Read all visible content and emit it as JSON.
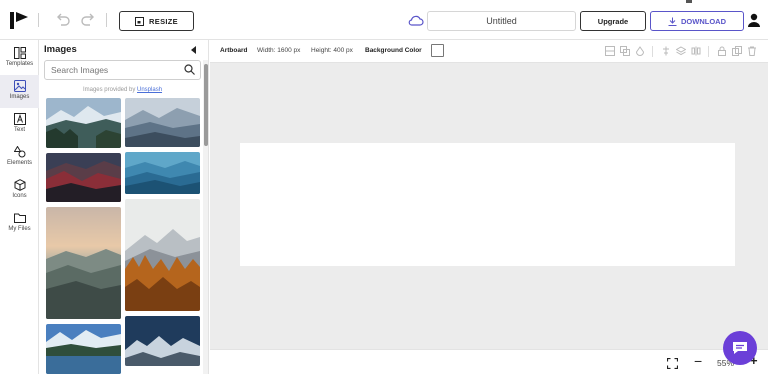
{
  "header": {
    "resize_label": "RESIZE",
    "title_value": "Untitled",
    "upgrade_label": "Upgrade",
    "download_label": "DOWNLOAD"
  },
  "sidebar": {
    "items": [
      {
        "label": "Templates",
        "icon": "templates-icon"
      },
      {
        "label": "Images",
        "icon": "image-icon",
        "active": true
      },
      {
        "label": "Text",
        "icon": "text-icon"
      },
      {
        "label": "Elements",
        "icon": "shapes-icon"
      },
      {
        "label": "Icons",
        "icon": "cube-icon"
      },
      {
        "label": "My Files",
        "icon": "folder-icon"
      }
    ]
  },
  "panel": {
    "title": "Images",
    "search_placeholder": "Search Images",
    "provided_text": "Images provided by",
    "provider_link": "Unsplash"
  },
  "artboard_bar": {
    "artboard_label": "Artboard",
    "width_text": "Width: 1600 px",
    "height_text": "Height: 400 px",
    "bg_color_label": "Background Color",
    "bg_color": "#ffffff"
  },
  "zoom": {
    "level": "55%"
  },
  "colors": {
    "accent": "#5a55c9",
    "chat": "#6b3fd8",
    "canvas": "#ececec"
  }
}
